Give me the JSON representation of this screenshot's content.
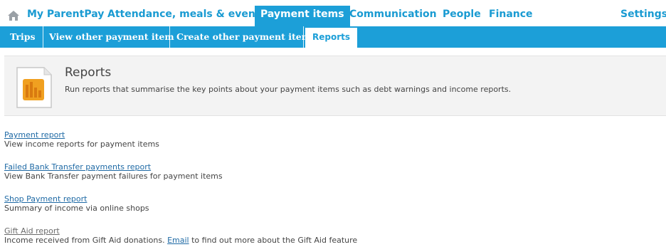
{
  "top_nav": {
    "home_icon": "home-icon",
    "tabs": [
      {
        "label": "My ParentPay"
      },
      {
        "label": "Attendance, meals & events"
      },
      {
        "label": "Payment items",
        "active": true
      },
      {
        "label": "Communication"
      },
      {
        "label": "People"
      },
      {
        "label": "Finance"
      },
      {
        "label": "Settings"
      }
    ]
  },
  "sub_nav": {
    "tabs": [
      {
        "label": "Trips"
      },
      {
        "label": "View other payment item"
      },
      {
        "label": "Create other payment item"
      },
      {
        "label": "Reports",
        "active": true
      }
    ]
  },
  "header": {
    "icon": "bar-chart-document-icon",
    "title": "Reports",
    "description": "Run reports that summarise the key points about your payment items such as debt warnings and income reports."
  },
  "reports": [
    {
      "link": "Payment report",
      "description": "View income reports for payment items"
    },
    {
      "link": "Failed Bank Transfer payments report",
      "description": "View Bank Transfer payment failures for payment items"
    },
    {
      "link": "Shop Payment report",
      "description": "Summary of income via online shops"
    },
    {
      "link": "Gift Aid report",
      "description_before": "Income received from Gift Aid donations. ",
      "description_link": "Email",
      "description_after": " to find out more about the Gift Aid feature"
    }
  ],
  "colors": {
    "brand_blue": "#1c9fd8",
    "link_blue": "#1f6aa5",
    "panel_bg": "#f3f3f3",
    "icon_orange": "#f0a020"
  }
}
